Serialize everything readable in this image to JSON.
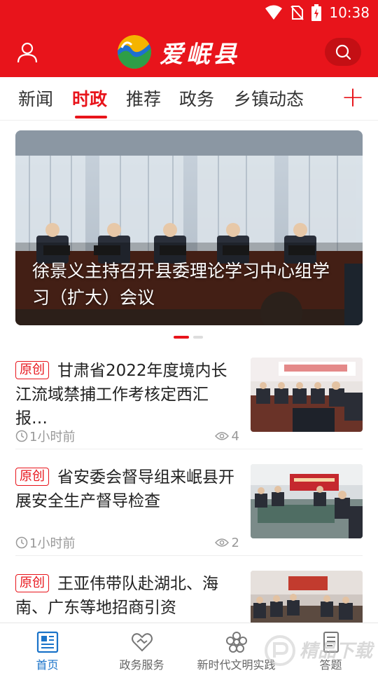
{
  "status_bar": {
    "time": "10:38",
    "icons": [
      "wifi-icon",
      "no-sim-icon",
      "battery-charging-icon"
    ]
  },
  "header": {
    "app_name": "爱岷县",
    "user_icon": "user-icon",
    "search_icon": "search-icon"
  },
  "tabs": [
    {
      "label": "新闻",
      "active": false
    },
    {
      "label": "时政",
      "active": true
    },
    {
      "label": "推荐",
      "active": false
    },
    {
      "label": "政务",
      "active": false
    },
    {
      "label": "乡镇动态",
      "active": false
    }
  ],
  "tab_add_label": "+",
  "banner": {
    "caption": "徐景义主持召开县委理论学习中心组学习（扩大）会议",
    "slide_count": 2,
    "active_slide": 1
  },
  "news": [
    {
      "badge": "原创",
      "title": "甘肃省2022年度境内长江流域禁捕工作考核定西汇报…",
      "time": "1小时前",
      "views": "4"
    },
    {
      "badge": "原创",
      "title": "省安委会督导组来岷县开展安全生产督导检查",
      "time": "1小时前",
      "views": "2"
    },
    {
      "badge": "原创",
      "title": "王亚伟带队赴湖北、海南、广东等地招商引资",
      "time": "",
      "views": ""
    }
  ],
  "bottom_nav": [
    {
      "label": "首页",
      "icon": "newspaper-icon",
      "active": true
    },
    {
      "label": "政务服务",
      "icon": "handshake-heart-icon",
      "active": false
    },
    {
      "label": "新时代文明实践",
      "icon": "flower-icon",
      "active": false
    },
    {
      "label": "答题",
      "icon": "document-icon",
      "active": false
    }
  ],
  "colors": {
    "brand_red": "#e8141b",
    "active_blue": "#1a73c9"
  }
}
